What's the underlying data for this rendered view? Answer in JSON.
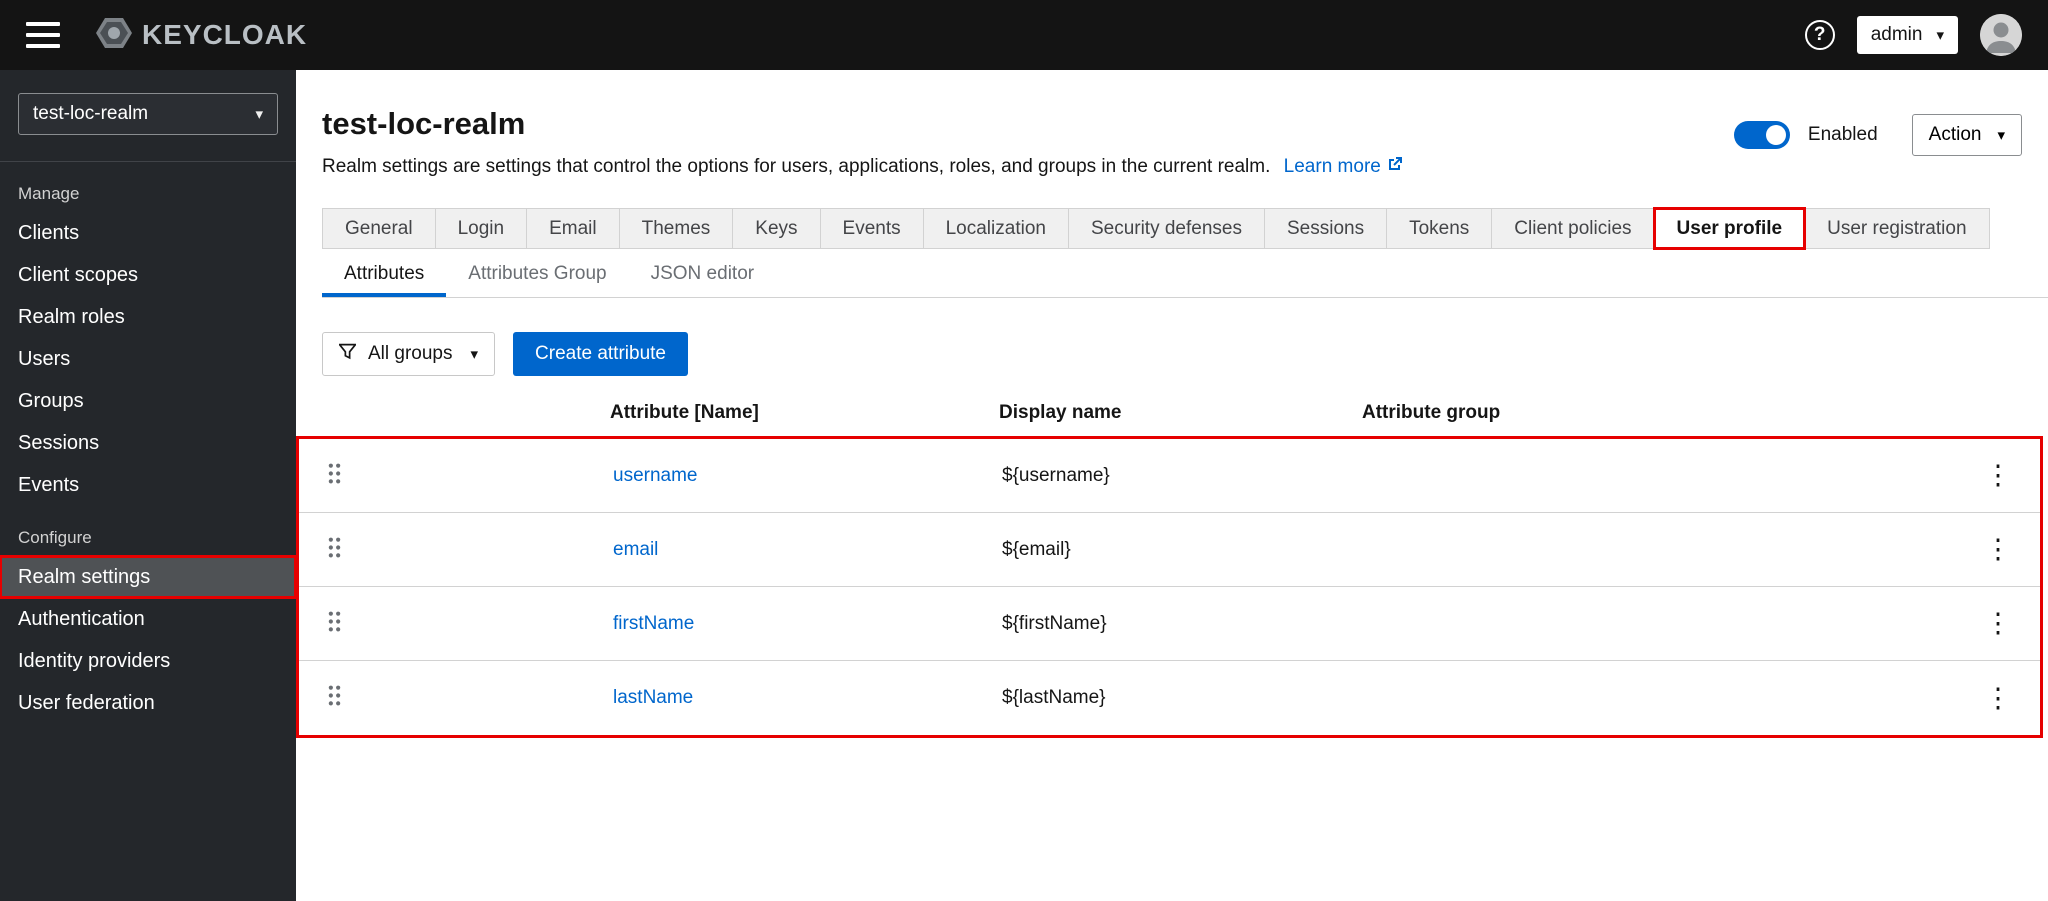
{
  "topbar": {
    "brand": "KEYCLOAK",
    "user_menu": "admin"
  },
  "icons": {
    "caret_down": "▾",
    "kebab": "⋮",
    "help": "?"
  },
  "sidebar": {
    "realm_selector": "test-loc-realm",
    "sections": [
      {
        "label": "Manage",
        "items": [
          "Clients",
          "Client scopes",
          "Realm roles",
          "Users",
          "Groups",
          "Sessions",
          "Events"
        ]
      },
      {
        "label": "Configure",
        "items": [
          "Realm settings",
          "Authentication",
          "Identity providers",
          "User federation"
        ]
      }
    ],
    "active_item": "Realm settings"
  },
  "header": {
    "title": "test-loc-realm",
    "description": "Realm settings are settings that control the options for users, applications, roles, and groups in the current realm.",
    "learn_more": "Learn more",
    "enabled_label": "Enabled",
    "enabled_state": "on",
    "action_button": "Action"
  },
  "tabs": {
    "items": [
      "General",
      "Login",
      "Email",
      "Themes",
      "Keys",
      "Events",
      "Localization",
      "Security defenses",
      "Sessions",
      "Tokens",
      "Client policies",
      "User profile",
      "User registration"
    ],
    "active": "User profile"
  },
  "subtabs": {
    "items": [
      "Attributes",
      "Attributes Group",
      "JSON editor"
    ],
    "active": "Attributes"
  },
  "toolbar": {
    "group_filter": "All groups",
    "create_button": "Create attribute"
  },
  "table": {
    "columns": [
      "Attribute [Name]",
      "Display name",
      "Attribute group"
    ],
    "rows": [
      {
        "name": "username",
        "display_name": "${username}",
        "group": ""
      },
      {
        "name": "email",
        "display_name": "${email}",
        "group": ""
      },
      {
        "name": "firstName",
        "display_name": "${firstName}",
        "group": ""
      },
      {
        "name": "lastName",
        "display_name": "${lastName}",
        "group": ""
      }
    ]
  },
  "colors": {
    "accent": "#0066cc",
    "annotation": "#e60000",
    "topbar_bg": "#141414",
    "sidebar_bg": "#24272b"
  }
}
